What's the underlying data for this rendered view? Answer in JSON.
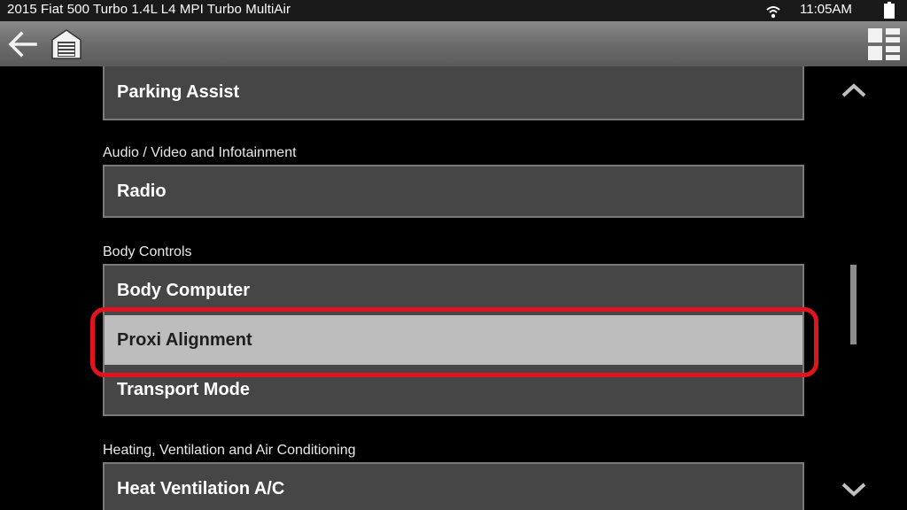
{
  "status_bar": {
    "vehicle_title": "2015 Fiat 500 Turbo 1.4L L4 MPI Turbo MultiAir",
    "time": "11:05AM",
    "icons": [
      "wifi-icon",
      "battery-icon"
    ]
  },
  "toolbar": {
    "icons": [
      "back-arrow-icon",
      "home-garage-icon",
      "grid-view-icon"
    ]
  },
  "list": {
    "top_item": "Parking Assist",
    "sections": [
      {
        "label": "Audio / Video and Infotainment",
        "items": [
          "Radio"
        ]
      },
      {
        "label": "Body Controls",
        "items": [
          "Body Computer",
          "Proxi Alignment",
          "Transport Mode"
        ]
      },
      {
        "label": "Heating, Ventilation and Air Conditioning",
        "items": [
          "Heat Ventilation A/C"
        ]
      }
    ],
    "selected_item": "Proxi Alignment"
  },
  "colors": {
    "highlight_ring": "#e0141e",
    "selected_row": "#bdbdbd",
    "row_background": "#464646",
    "row_border": "#7a7a7a"
  }
}
